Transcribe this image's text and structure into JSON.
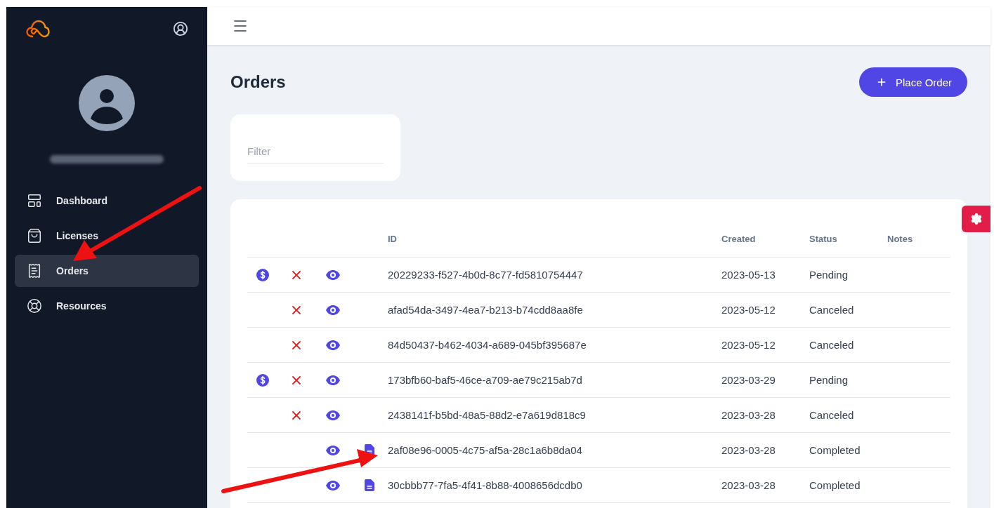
{
  "sidebar": {
    "items": [
      {
        "label": "Dashboard",
        "selected": false
      },
      {
        "label": "Licenses",
        "selected": false
      },
      {
        "label": "Orders",
        "selected": true
      },
      {
        "label": "Resources",
        "selected": false
      }
    ]
  },
  "page": {
    "title": "Orders",
    "place_order_button": "Place Order",
    "filter": {
      "placeholder": "Filter"
    }
  },
  "table": {
    "columns": [
      "ID",
      "Created",
      "Status",
      "Notes"
    ],
    "rows": [
      {
        "id": "20229233-f527-4b0d-8c77-fd5810754447",
        "created": "2023-05-13",
        "status": "Pending",
        "pay": true,
        "cancel": true,
        "view": true,
        "invoice": false
      },
      {
        "id": "afad54da-3497-4ea7-b213-b74cdd8aa8fe",
        "created": "2023-05-12",
        "status": "Canceled",
        "pay": false,
        "cancel": true,
        "view": true,
        "invoice": false
      },
      {
        "id": "84d50437-b462-4034-a689-045bf395687e",
        "created": "2023-05-12",
        "status": "Canceled",
        "pay": false,
        "cancel": true,
        "view": true,
        "invoice": false
      },
      {
        "id": "173bfb60-baf5-46ce-a709-ae79c215ab7d",
        "created": "2023-03-29",
        "status": "Pending",
        "pay": true,
        "cancel": true,
        "view": true,
        "invoice": false
      },
      {
        "id": "2438141f-b5bd-48a5-88d2-e7a619d818c9",
        "created": "2023-03-28",
        "status": "Canceled",
        "pay": false,
        "cancel": true,
        "view": true,
        "invoice": false
      },
      {
        "id": "2af08e96-0005-4c75-af5a-28c1a6b8da04",
        "created": "2023-03-28",
        "status": "Completed",
        "pay": false,
        "cancel": false,
        "view": true,
        "invoice": true
      },
      {
        "id": "30cbbb77-7fa5-4f41-8b88-4008656dcdb0",
        "created": "2023-03-28",
        "status": "Completed",
        "pay": false,
        "cancel": false,
        "view": true,
        "invoice": true
      }
    ]
  }
}
